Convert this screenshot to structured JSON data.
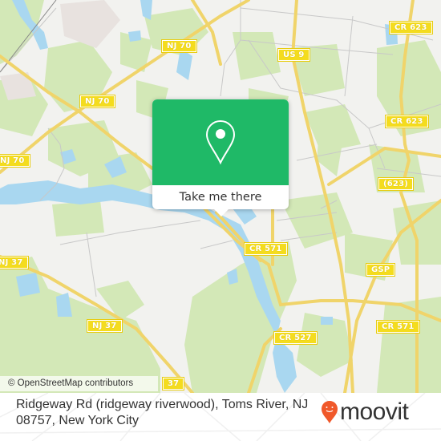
{
  "map": {
    "road_shields": [
      {
        "id": "nj70-top",
        "label": "NJ 70"
      },
      {
        "id": "nj70-mid",
        "label": "NJ 70"
      },
      {
        "id": "nj70-left",
        "label": "NJ 70"
      },
      {
        "id": "us9",
        "label": "US 9"
      },
      {
        "id": "cr623-top",
        "label": "CR 623"
      },
      {
        "id": "cr623-mid",
        "label": "CR 623"
      },
      {
        "id": "cr623-paren",
        "label": "(623)"
      },
      {
        "id": "nj37-left",
        "label": "NJ 37"
      },
      {
        "id": "nj37-mid",
        "label": "NJ 37"
      },
      {
        "id": "nj37-bottom",
        "label": "37"
      },
      {
        "id": "cr571-mid",
        "label": "CR 571"
      },
      {
        "id": "gsp",
        "label": "GSP"
      },
      {
        "id": "cr527",
        "label": "CR 527"
      },
      {
        "id": "cr571-right",
        "label": "CR 571"
      }
    ],
    "attribution": "© OpenStreetMap contributors",
    "colors": {
      "land": "#f2f2ef",
      "park": "#cfe6b0",
      "water": "#a8d8f0",
      "road": "#f5de6b",
      "shield": "#f4dc1e"
    }
  },
  "popup": {
    "icon": "location-pin-icon",
    "button_label": "Take me there",
    "color": "#1fb967"
  },
  "footer": {
    "address": "Ridgeway Rd (ridgeway riverwood), Toms River, NJ 08757, New York City",
    "logo_text": "moovit",
    "logo_color": "#f0582a"
  }
}
